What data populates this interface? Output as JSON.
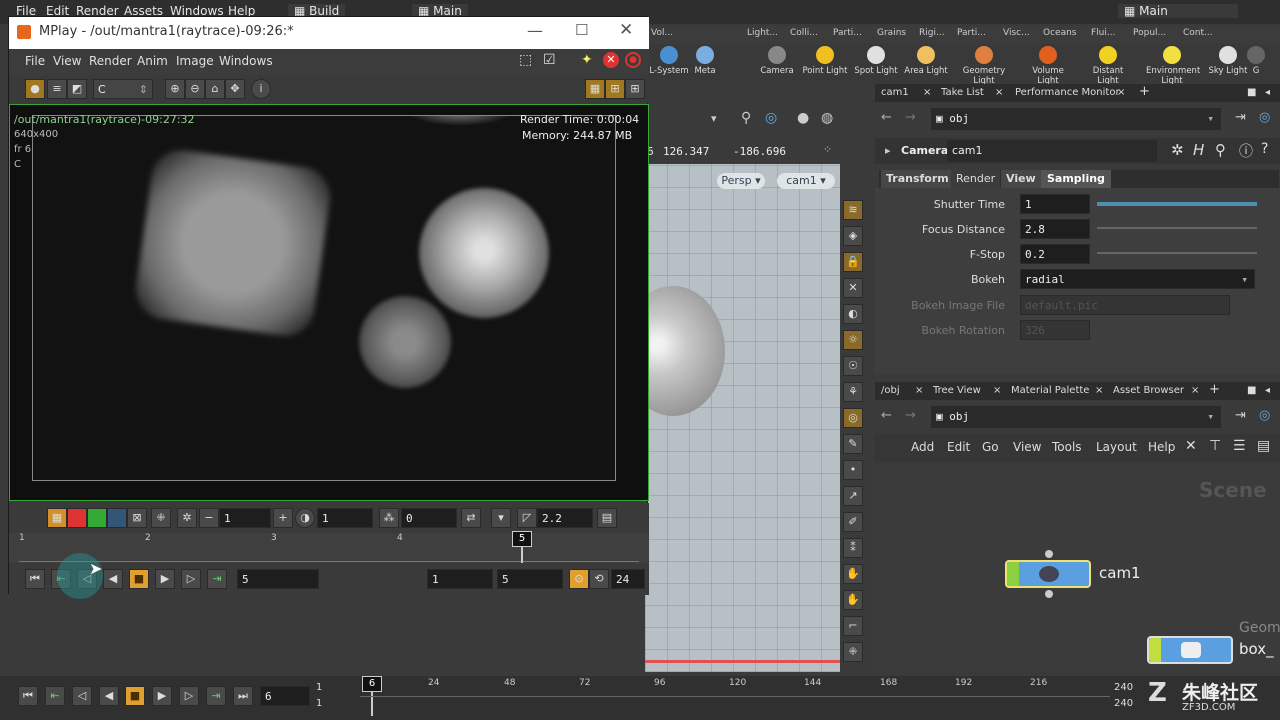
{
  "main_menu": {
    "items": [
      "File",
      "Edit",
      "Render",
      "Assets",
      "Windows",
      "Help"
    ],
    "build_label": "Build",
    "main_label": "Main",
    "main_label_right": "Main"
  },
  "shelf_tabs": [
    "Vol...",
    "Light...",
    "Colli...",
    "Parti...",
    "Grains",
    "Rigi...",
    "Parti...",
    "Visc...",
    "Oceans",
    "Flui...",
    "Popul...",
    "Cont..."
  ],
  "shelf_tools": [
    {
      "label": "L-System",
      "color": "#4a8fd0"
    },
    {
      "label": "Meta",
      "color": "#7aaee0"
    },
    {
      "label": "Camera",
      "color": "#888"
    },
    {
      "label": "Point Light",
      "color": "#f0c020"
    },
    {
      "label": "Spot Light",
      "color": "#e0e0e0"
    },
    {
      "label": "Area Light",
      "color": "#f0c060"
    },
    {
      "label": "Geometry Light",
      "color": "#e08040"
    },
    {
      "label": "Volume Light",
      "color": "#e06020"
    },
    {
      "label": "Distant Light",
      "color": "#f0d020"
    },
    {
      "label": "Environment Light",
      "color": "#f0e040"
    },
    {
      "label": "Sky Light",
      "color": "#e0e0e0"
    },
    {
      "label": "G",
      "color": "#666"
    }
  ],
  "viewport": {
    "coord_a": "126.347",
    "coord_b": "-186.696",
    "coord_prefix": "6",
    "persp_label": "Persp",
    "cam_label": "cam1"
  },
  "param_panel": {
    "tabs": [
      "cam1",
      "Take List",
      "Performance Monitor"
    ],
    "path": "obj",
    "node_type": "Camera",
    "node_name": "cam1",
    "subtabs": [
      "Transform",
      "Render",
      "View",
      "Sampling"
    ],
    "params": [
      {
        "label": "Shutter Time",
        "value": "1",
        "slider": 1.0,
        "enabled": true
      },
      {
        "label": "Focus Distance",
        "value": "2.8",
        "slider": 0.0,
        "enabled": true
      },
      {
        "label": "F-Stop",
        "value": "0.2",
        "slider": 0.0,
        "enabled": true
      },
      {
        "label": "Bokeh",
        "value": "radial",
        "enabled": true
      },
      {
        "label": "Bokeh Image File",
        "value": "default.pic",
        "enabled": false
      },
      {
        "label": "Bokeh Rotation",
        "value": "326",
        "enabled": false
      }
    ]
  },
  "network_panel": {
    "tabs": [
      "/obj",
      "Tree View",
      "Material Palette",
      "Asset Browser"
    ],
    "path": "obj",
    "menu": [
      "Add",
      "Edit",
      "Go",
      "View",
      "Tools",
      "Layout",
      "Help"
    ],
    "scene_label": "Scene",
    "node_cam": "cam1",
    "node_geo_label": "Geom",
    "node_box_label": "box_"
  },
  "mplay": {
    "title": "MPlay - /out/mantra1(raytrace)-09:26:*",
    "menu": [
      "File",
      "View",
      "Render",
      "Anim",
      "Image",
      "Windows"
    ],
    "channel": "C",
    "overlay_path": "/out/mantra1(raytrace)-09:27:32",
    "overlay_res": "640x400",
    "overlay_frame": "fr 6",
    "overlay_channel": "C",
    "render_time": "Render Time: 0:00:04",
    "memory": "Memory:   244.87 MB",
    "ctl_field1": "1",
    "ctl_field2": "1",
    "ctl_field3": "0",
    "gamma": "2.2",
    "timeline_ticks": [
      "1",
      "2",
      "3",
      "4",
      "5"
    ],
    "current_frame_marker": "5",
    "frame_field": "5",
    "range_start": "1",
    "range_end": "5",
    "fps": "24"
  },
  "playbar": {
    "frame": "6",
    "start": "1",
    "start2": "1",
    "current_marker": "6",
    "ticks": [
      "24",
      "48",
      "72",
      "96",
      "120",
      "144",
      "168",
      "192",
      "216"
    ],
    "end": "240",
    "end2": "240"
  },
  "watermark": {
    "text": "朱峰社区",
    "sub": "ZF3D.COM"
  }
}
